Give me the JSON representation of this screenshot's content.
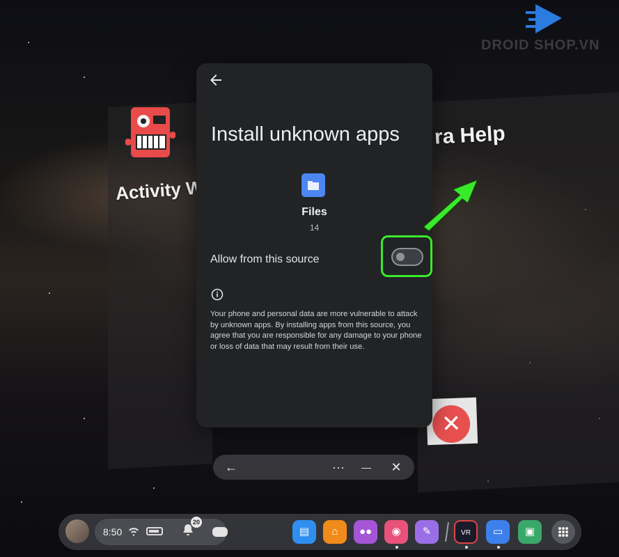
{
  "watermark": {
    "text": "DROID SHOP.VN"
  },
  "background": {
    "left_app_label": "Activity Wa",
    "right_app_label": "ra Help"
  },
  "dialog": {
    "back_icon": "arrow-left-icon",
    "title": "Install unknown apps",
    "app": {
      "name": "Files",
      "version": "14",
      "icon": "folder-icon"
    },
    "setting": {
      "label": "Allow from this source",
      "enabled": false
    },
    "info_icon": "info-icon",
    "warning": "Your phone and personal data are more vulnerable to attack by unknown apps. By installing apps from this source, you agree that you are responsible for any damage to your phone or loss of data that may result from their use."
  },
  "window_controls": {
    "back": "←",
    "more": "···",
    "minimize": "—",
    "close": "✕"
  },
  "taskbar": {
    "time": "8:50",
    "notification_count": "20",
    "apps": [
      {
        "name": "browser-app-icon",
        "color": "#2f8ff0"
      },
      {
        "name": "store-app-icon",
        "color": "#f08a1a"
      },
      {
        "name": "people-app-icon",
        "color": "#a456d6"
      },
      {
        "name": "camera-app-icon",
        "color": "#e8527a"
      },
      {
        "name": "explore-app-icon",
        "color": "#9a6ee6"
      },
      {
        "name": "vr-station-app-icon",
        "color": "#1a1a2a"
      },
      {
        "name": "files-app-icon",
        "color": "#3d80ec"
      },
      {
        "name": "gallery-app-icon",
        "color": "#3aa86a"
      }
    ]
  },
  "colors": {
    "highlight": "#39ea2b",
    "dialog_bg": "#212325"
  }
}
